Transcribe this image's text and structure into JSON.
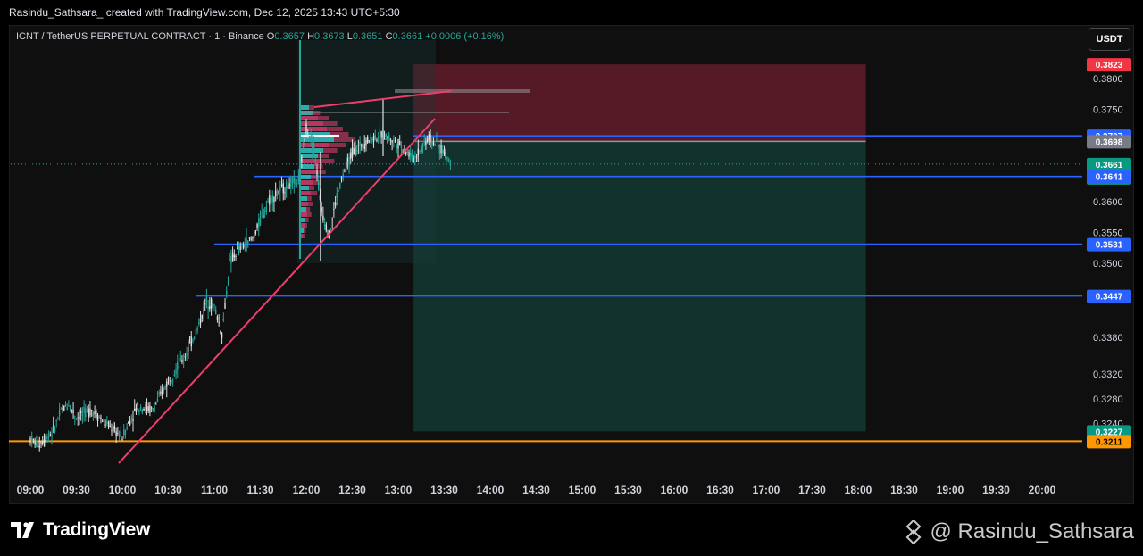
{
  "header": {
    "caption": "Rasindu_Sathsara_ created with TradingView.com, Dec 12, 2025 13:43 UTC+5:30"
  },
  "legend": {
    "symbol": "ICNT / TetherUS PERPETUAL CONTRACT · 1 · Binance",
    "o_label": "O",
    "o_value": "0.3657",
    "h_label": "H",
    "h_value": "0.3673",
    "l_label": "L",
    "l_value": "0.3651",
    "c_label": "C",
    "c_value": "0.3661",
    "change": "+0.0006 (+0.16%)"
  },
  "currency_button": "USDT",
  "footer": {
    "brand": "TradingView",
    "watermark": "@ Rasindu_Sathsara"
  },
  "colors": {
    "up": "#26a69a",
    "down": "#e0e0e0",
    "stop_zone": "#6e1f2e",
    "target_zone": "#133a32",
    "level_line": "#2962ff",
    "support_line": "#ff9800",
    "trendline": "#f23d6b"
  },
  "chart_data": {
    "type": "candlestick",
    "title": "ICNT / TetherUS PERPETUAL CONTRACT · 1 · Binance",
    "x_ticks": [
      "09:00",
      "09:30",
      "10:00",
      "10:30",
      "11:00",
      "11:30",
      "12:00",
      "12:30",
      "13:00",
      "13:30",
      "14:00",
      "14:30",
      "15:00",
      "15:30",
      "16:00",
      "16:30",
      "17:00",
      "17:30",
      "18:00",
      "18:30",
      "19:00",
      "19:30",
      "20:00"
    ],
    "y_ticks": [
      "0.3800",
      "0.3750",
      "0.3600",
      "0.3550",
      "0.3500",
      "0.3380",
      "0.3320",
      "0.3280",
      "0.3240"
    ],
    "price_tags": [
      {
        "value": "0.3823",
        "bg": "#f23645",
        "fg": "#ffffff"
      },
      {
        "value": "0.3707",
        "bg": "#2962ff",
        "fg": "#ffffff"
      },
      {
        "value": "0.3698",
        "bg": "#787b86",
        "fg": "#ffffff"
      },
      {
        "value": "0.3661",
        "sub": "00:04",
        "bg": "#089981",
        "fg": "#ffffff"
      },
      {
        "value": "0.3641",
        "bg": "#2962ff",
        "fg": "#ffffff"
      },
      {
        "value": "0.3531",
        "bg": "#2962ff",
        "fg": "#ffffff"
      },
      {
        "value": "0.3447",
        "bg": "#2962ff",
        "fg": "#ffffff"
      },
      {
        "value": "0.3227",
        "bg": "#089981",
        "fg": "#ffffff"
      },
      {
        "value": "0.3211",
        "bg": "#ff9800",
        "fg": "#000000"
      }
    ],
    "horizontal_levels": [
      {
        "price": 0.3707,
        "color": "#2962ff"
      },
      {
        "price": 0.3641,
        "color": "#2962ff"
      },
      {
        "price": 0.3531,
        "color": "#2962ff"
      },
      {
        "price": 0.3447,
        "color": "#2962ff"
      },
      {
        "price": 0.3211,
        "color": "#ff9800"
      }
    ],
    "position": {
      "entry": 0.3698,
      "stop": 0.3823,
      "target": 0.3227,
      "start_time": "13:10",
      "end_time": "18:05"
    },
    "ohlc_path": [
      [
        "09:00",
        0.3215
      ],
      [
        "09:05",
        0.3205
      ],
      [
        "09:15",
        0.3228
      ],
      [
        "09:20",
        0.326
      ],
      [
        "09:25",
        0.3272
      ],
      [
        "09:30",
        0.325
      ],
      [
        "09:40",
        0.3262
      ],
      [
        "09:50",
        0.3238
      ],
      [
        "10:00",
        0.3218
      ],
      [
        "10:05",
        0.3245
      ],
      [
        "10:10",
        0.3268
      ],
      [
        "10:20",
        0.3262
      ],
      [
        "10:30",
        0.331
      ],
      [
        "10:40",
        0.3345
      ],
      [
        "10:50",
        0.34
      ],
      [
        "10:55",
        0.344
      ],
      [
        "11:00",
        0.343
      ],
      [
        "11:05",
        0.3385
      ],
      [
        "11:10",
        0.35
      ],
      [
        "11:15",
        0.352
      ],
      [
        "11:25",
        0.354
      ],
      [
        "11:35",
        0.36
      ],
      [
        "11:45",
        0.3622
      ],
      [
        "11:55",
        0.3635
      ],
      [
        "12:00",
        0.372
      ],
      [
        "12:05",
        0.369
      ],
      [
        "12:10",
        0.3585
      ],
      [
        "12:15",
        0.3545
      ],
      [
        "12:20",
        0.361
      ],
      [
        "12:25",
        0.365
      ],
      [
        "12:30",
        0.368
      ],
      [
        "12:40",
        0.37
      ],
      [
        "12:50",
        0.371
      ],
      [
        "13:00",
        0.3695
      ],
      [
        "13:10",
        0.367
      ],
      [
        "13:20",
        0.3705
      ],
      [
        "13:30",
        0.368
      ],
      [
        "13:35",
        0.3661
      ]
    ]
  }
}
